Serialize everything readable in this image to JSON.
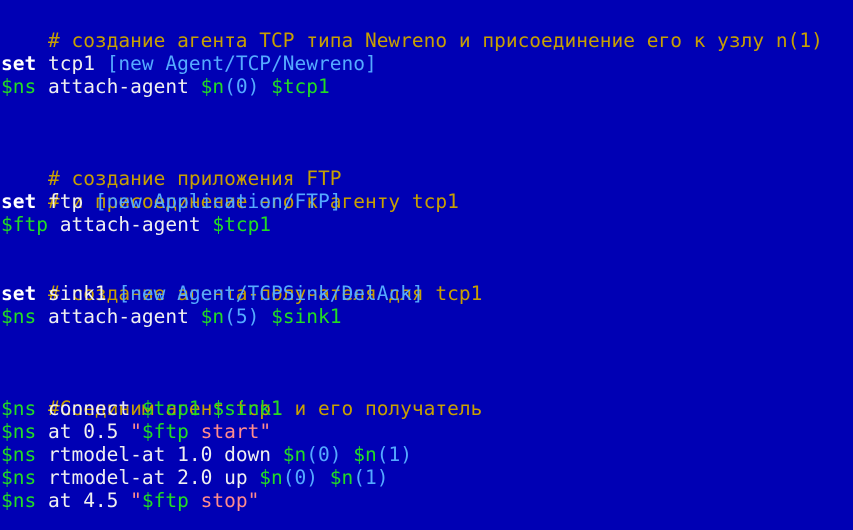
{
  "code": {
    "l1_comment": "# создание агента TCP типа Newreno и присоединение его к узлу n(1)",
    "l2_set": "set",
    "l2_name": " tcp1 ",
    "l2_bracket": "[new Agent/TCP/Newreno]",
    "l3_var": "$ns",
    "l3_cmd": " attach-agent ",
    "l3_n": "$n",
    "l3_arg": "(0)",
    "l3_sp": " ",
    "l3_obj": "$tcp1",
    "l4_comment": "# создание приложения FTP",
    "l5_comment": "# и присоединение его к агенту tcp1",
    "l6_set": "set",
    "l6_name": " ftp ",
    "l6_bracket": "[new Application/FTP]",
    "l7_var": "$ftp",
    "l7_cmd": " attach-agent ",
    "l7_obj": "$tcp1",
    "l8_comment": "# создание агента-получателя для tcp1",
    "l9_set": "set",
    "l9_name": " sink1 ",
    "l9_bracket": "[new Agent/TCPSink/DelAck]",
    "l10_var": "$ns",
    "l10_cmd": " attach-agent ",
    "l10_n": "$n",
    "l10_arg": "(5)",
    "l10_sp": " ",
    "l10_obj": "$sink1",
    "l11_comment": "#Соединим агент tcp1 и его получатель",
    "l12_var": "$ns",
    "l12_cmd": " connect ",
    "l12_a": "$tcp1",
    "l12_sp": " ",
    "l12_b": "$sink1",
    "l13_var": "$ns",
    "l13_cmd": " at 0.5 ",
    "l13_q1": "\"",
    "l13_sv": "$ftp",
    "l13_str": " start\"",
    "l14_var": "$ns",
    "l14_cmd": " rtmodel-at 1.0 down ",
    "l14_n1": "$n",
    "l14_a1": "(0)",
    "l14_sp": " ",
    "l14_n2": "$n",
    "l14_a2": "(1)",
    "l15_var": "$ns",
    "l15_cmd": " rtmodel-at 2.0 up ",
    "l15_n1": "$n",
    "l15_a1": "(0)",
    "l15_sp": " ",
    "l15_n2": "$n",
    "l15_a2": "(1)",
    "l16_var": "$ns",
    "l16_cmd": " at 4.5 ",
    "l16_q1": "\"",
    "l16_sv": "$ftp",
    "l16_str": " stop\""
  },
  "colors": {
    "background": "#0000b4",
    "comment": "#c8a000",
    "keyword": "#ffffff",
    "variable": "#22dd22",
    "bracket": "#55aaff",
    "string": "#ff8c8c"
  }
}
